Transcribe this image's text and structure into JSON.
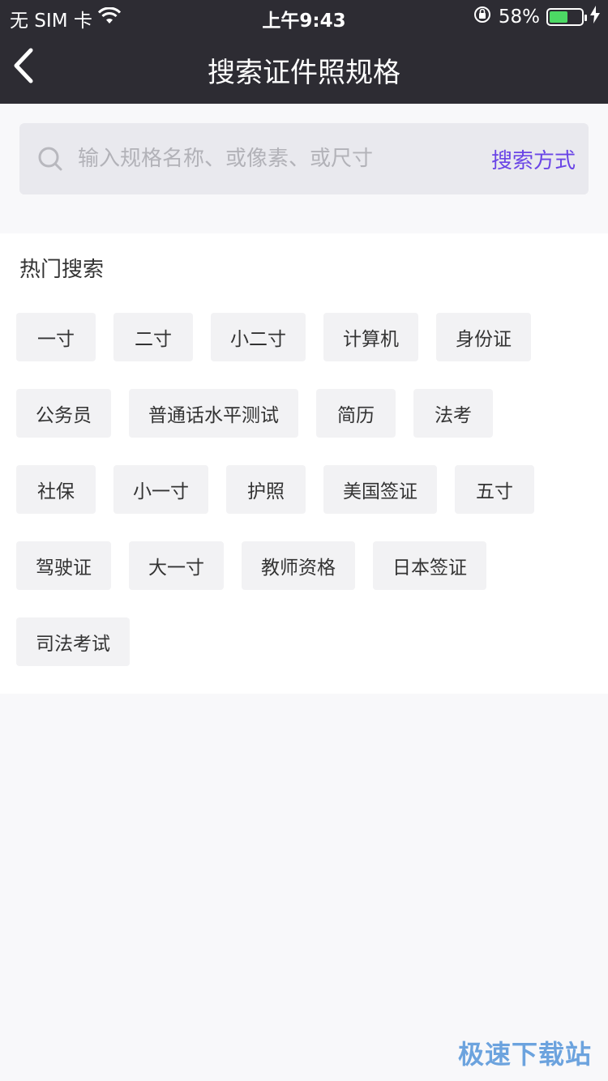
{
  "status": {
    "carrier": "无 SIM 卡",
    "time": "上午9:43",
    "battery": "58%",
    "battery_level": 0.58
  },
  "header": {
    "title": "搜索证件照规格"
  },
  "search": {
    "placeholder": "输入规格名称、或像素、或尺寸",
    "mode_label": "搜索方式"
  },
  "hot": {
    "title": "热门搜索",
    "tags": [
      "一寸",
      "二寸",
      "小二寸",
      "计算机",
      "身份证",
      "公务员",
      "普通话水平测试",
      "简历",
      "法考",
      "社保",
      "小一寸",
      "护照",
      "美国签证",
      "五寸",
      "驾驶证",
      "大一寸",
      "教师资格",
      "日本签证",
      "司法考试"
    ]
  },
  "watermark": "极速下载站",
  "colors": {
    "header_bg": "#2d2c33",
    "accent": "#6a45e6"
  }
}
